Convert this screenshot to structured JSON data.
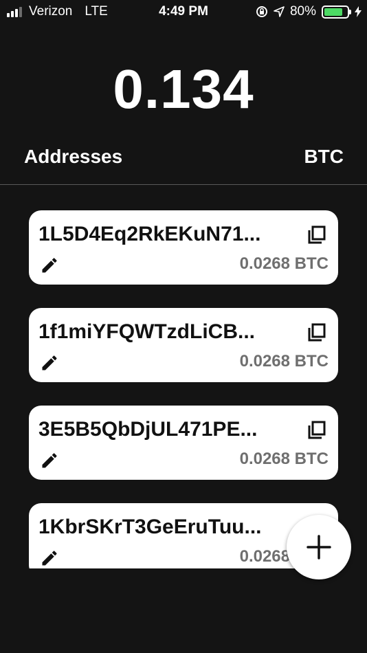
{
  "status_bar": {
    "carrier": "Verizon",
    "network": "LTE",
    "time": "4:49 PM",
    "battery_percent": "80%",
    "battery_level": 0.8,
    "icons": [
      "signal-icon",
      "rotation-lock-icon",
      "location-arrow-icon",
      "battery-icon",
      "charging-bolt-icon"
    ]
  },
  "wallet": {
    "balance": "0.134"
  },
  "header": {
    "title": "Addresses",
    "unit": "BTC"
  },
  "addresses": [
    {
      "address": "1L5D4Eq2RkEKuN71...",
      "amount": "0.0268 BTC"
    },
    {
      "address": "1f1miYFQWTzdLiCB...",
      "amount": "0.0268 BTC"
    },
    {
      "address": "3E5B5QbDjUL471PE...",
      "amount": "0.0268 BTC"
    },
    {
      "address": "1KbrSKrT3GeEruTuu...",
      "amount": "0.0268 BTC"
    }
  ],
  "fab": {
    "icon": "plus-icon"
  },
  "colors": {
    "background": "#141414",
    "card": "#ffffff",
    "amount_text": "#6f6f6f",
    "battery": "#4cd964"
  }
}
